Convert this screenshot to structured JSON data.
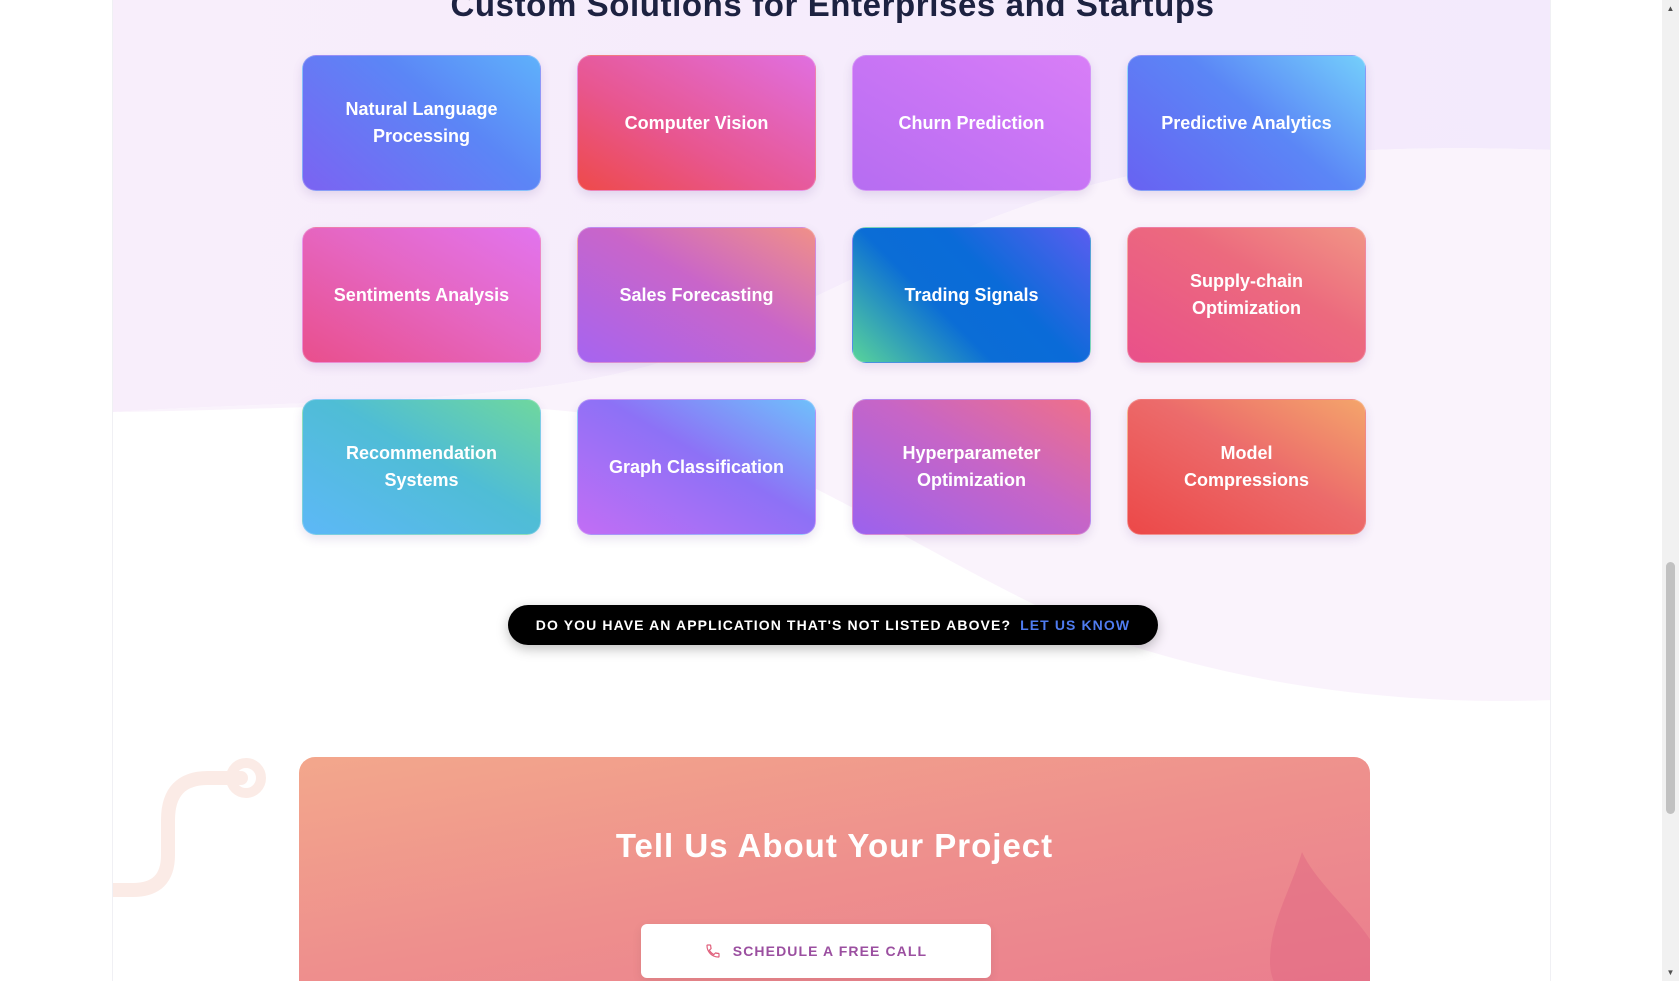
{
  "section": {
    "title": "Custom Solutions for Enterprises and Startups"
  },
  "solutions": [
    {
      "label": "Natural Language Processing",
      "gradient": "linear-gradient(220deg, #5fb1fb 0%, #5b86f6 40%, #7b63f2 100%)"
    },
    {
      "label": "Computer Vision",
      "gradient": "linear-gradient(30deg, #ee4a4a 0%, #e8568f 40%, #e06fe0 100%)"
    },
    {
      "label": "Churn Prediction",
      "gradient": "linear-gradient(30deg, #b66df1 0%, #c975f5 55%, #d87ef7 100%)"
    },
    {
      "label": "Predictive Analytics",
      "gradient": "linear-gradient(220deg, #74cffb 0%, #5b86f6 45%, #6862f2 100%)"
    },
    {
      "label": "Sentiments Analysis",
      "gradient": "linear-gradient(30deg, #e94f8c 0%, #e567c4 55%, #e274ee 100%)"
    },
    {
      "label": "Sales Forecasting",
      "gradient": "linear-gradient(30deg, #a664f0 0%, #c965c9 55%, #f09088 100%)"
    },
    {
      "label": "Trading Signals",
      "gradient": "linear-gradient(45deg, #59d49a 0%, #0b6dd6 38%, #0a6bd8 60%, #5a5df0 100%)"
    },
    {
      "label": "Supply-chain Optimization",
      "gradient": "linear-gradient(30deg, #e9508a 0%, #ec6a7e 60%, #f19585 100%)"
    },
    {
      "label": "Recommendation Systems",
      "gradient": "linear-gradient(30deg, #5db8f7 0%, #4fbdd5 55%, #6fd79e 100%)"
    },
    {
      "label": "Graph Classification",
      "gradient": "linear-gradient(30deg, #c26ef5 0%, #8d71f6 55%, #6fc0fb 100%)"
    },
    {
      "label": "Hyperparameter Optimization",
      "gradient": "linear-gradient(30deg, #9b62ee 0%, #c765c6 55%, #ef7089 100%)"
    },
    {
      "label": "Model Compressions",
      "gradient": "linear-gradient(30deg, #ec4848 0%, #ec6b6b 55%, #f4a56b 100%)"
    }
  ],
  "cta": {
    "question": "DO YOU HAVE AN APPLICATION THAT'S NOT LISTED ABOVE?",
    "link": "LET US KNOW"
  },
  "project": {
    "title": "Tell Us About Your Project",
    "button_label": "SCHEDULE A FREE CALL",
    "button_icon": "phone-icon"
  },
  "colors": {
    "heading": "#1d2241",
    "cta_link": "#4f7cf0",
    "call_label": "#9b4fa0",
    "wave": "#f6ecfb"
  }
}
